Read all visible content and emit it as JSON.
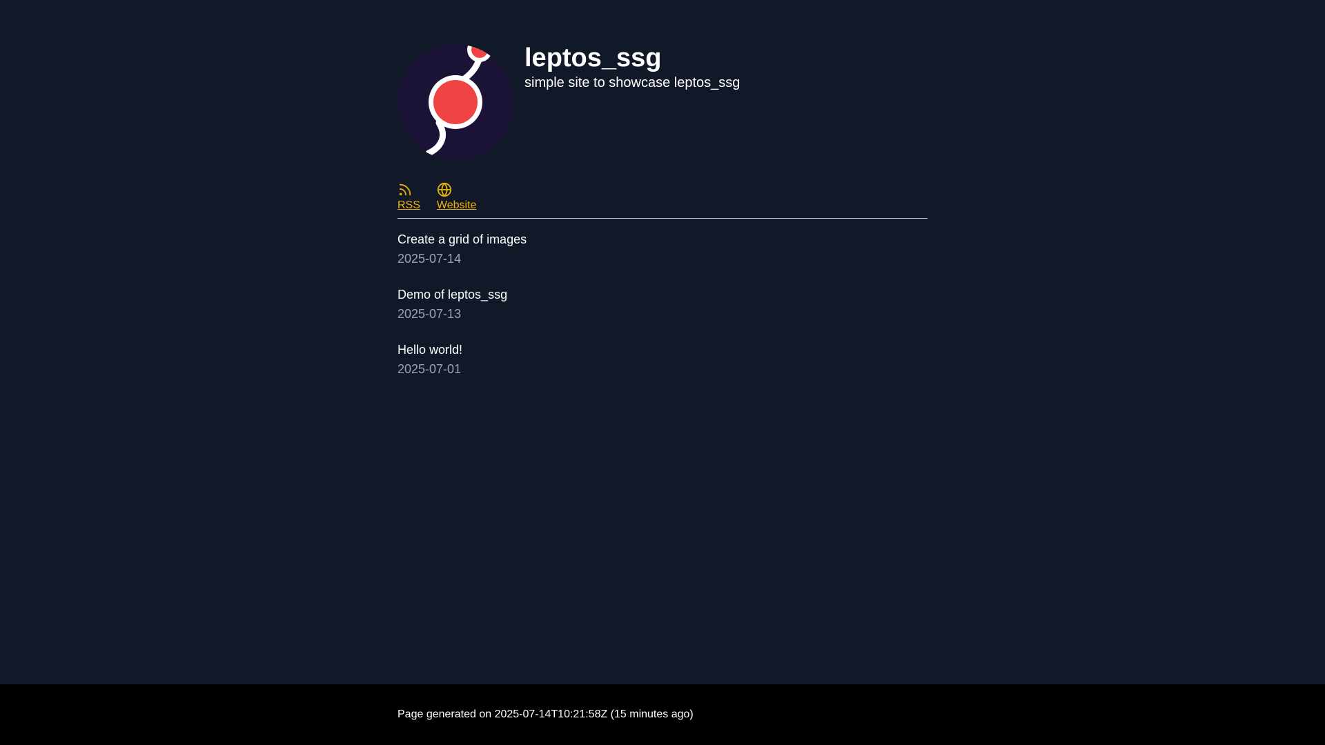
{
  "site": {
    "title": "leptos_ssg",
    "subtitle": "simple site to showcase leptos_ssg"
  },
  "avatar": {
    "icon": "leptos-logo-icon",
    "bg_color": "#1a1336",
    "accent_color": "#ef4444"
  },
  "links": [
    {
      "label": "RSS",
      "icon": "rss-icon"
    },
    {
      "label": "Website",
      "icon": "globe-icon"
    }
  ],
  "posts": [
    {
      "title": "Create a grid of images",
      "date": "2025-07-14"
    },
    {
      "title": "Demo of leptos_ssg",
      "date": "2025-07-13"
    },
    {
      "title": "Hello world!",
      "date": "2025-07-01"
    }
  ],
  "footer": {
    "text": "Page generated on 2025-07-14T10:21:58Z (15 minutes ago)"
  },
  "colors": {
    "background": "#111827",
    "footer_background": "#000000",
    "link": "#eab308",
    "date": "#9ca3af",
    "divider": "#d1d5db"
  }
}
